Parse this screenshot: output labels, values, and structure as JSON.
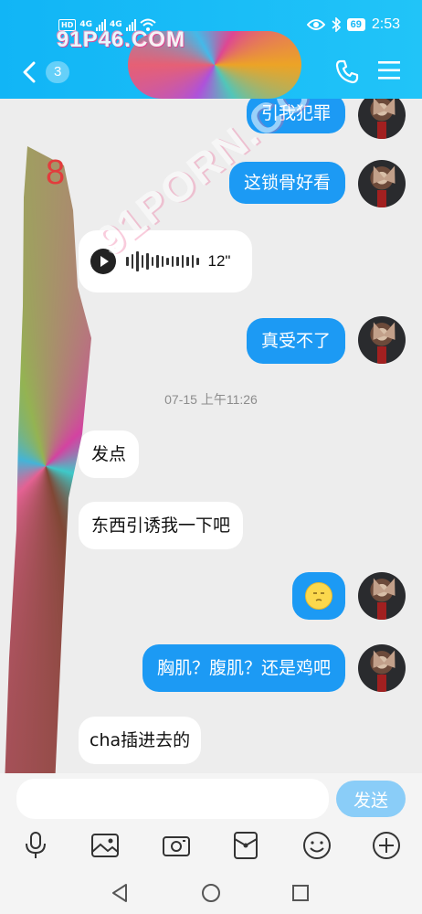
{
  "status_bar": {
    "left_chips": [
      "HD",
      "4G",
      "4G"
    ],
    "right_icons": [
      "eye-icon",
      "bluetooth-icon"
    ],
    "battery": "69",
    "time": "2:53"
  },
  "header": {
    "unread_count": "3",
    "watermark": "91P46.COM",
    "icons": [
      "back-chevron-icon",
      "phone-icon",
      "menu-icon"
    ]
  },
  "chat": {
    "watermark": "91PORN.COM",
    "stray_mark": "8",
    "messages": [
      {
        "dir": "out",
        "text": "引我犯罪"
      },
      {
        "dir": "out",
        "text": "这锁骨好看"
      },
      {
        "dir": "in",
        "type": "voice",
        "duration": "12\""
      },
      {
        "dir": "out",
        "text": "真受不了"
      },
      {
        "dir": "in",
        "text": "发点"
      },
      {
        "dir": "in",
        "text": "东西引诱我一下吧"
      },
      {
        "dir": "out",
        "type": "emoji",
        "text": "emoji-face"
      },
      {
        "dir": "out",
        "text": "胸肌？腹肌？还是鸡吧"
      },
      {
        "dir": "in",
        "text": "cha插进去的"
      }
    ],
    "timestamp": "07-15 上午11:26"
  },
  "input": {
    "value": "",
    "placeholder": "",
    "send_label": "发送"
  },
  "toolbar": {
    "icons": [
      "microphone-icon",
      "image-icon",
      "camera-icon",
      "red-packet-icon",
      "emoji-icon",
      "plus-icon"
    ]
  },
  "system_nav": [
    "back-triangle-icon",
    "home-circle-icon",
    "recents-square-icon"
  ],
  "colors": {
    "header": "#17B8F6",
    "outgoing_bubble": "#1C9AF4",
    "incoming_bubble": "#FFFFFF",
    "background": "#EDEDED",
    "send_button": "#8ACDF8"
  }
}
